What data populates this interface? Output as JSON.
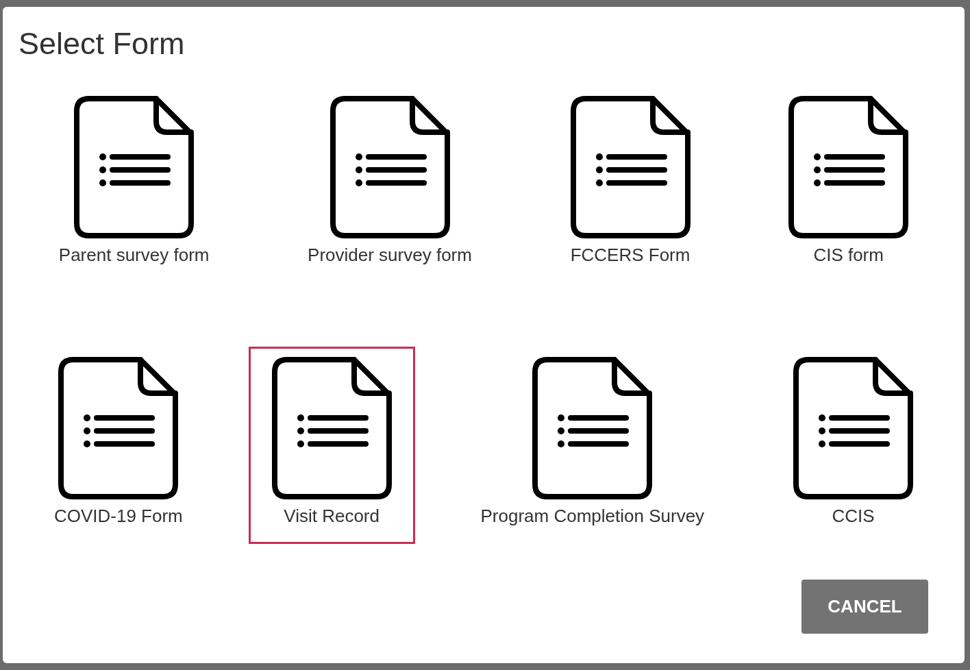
{
  "dialog": {
    "title": "Select Form",
    "forms": [
      {
        "label": "Parent survey form",
        "selected": false
      },
      {
        "label": "Provider survey form",
        "selected": false
      },
      {
        "label": "FCCERS Form",
        "selected": false
      },
      {
        "label": "CIS form",
        "selected": false
      },
      {
        "label": "COVID-19 Form",
        "selected": false
      },
      {
        "label": "Visit Record",
        "selected": true
      },
      {
        "label": "Program Completion Survey",
        "selected": false
      },
      {
        "label": "CCIS",
        "selected": false
      }
    ],
    "buttons": [
      {
        "label": "CANCEL"
      }
    ]
  }
}
